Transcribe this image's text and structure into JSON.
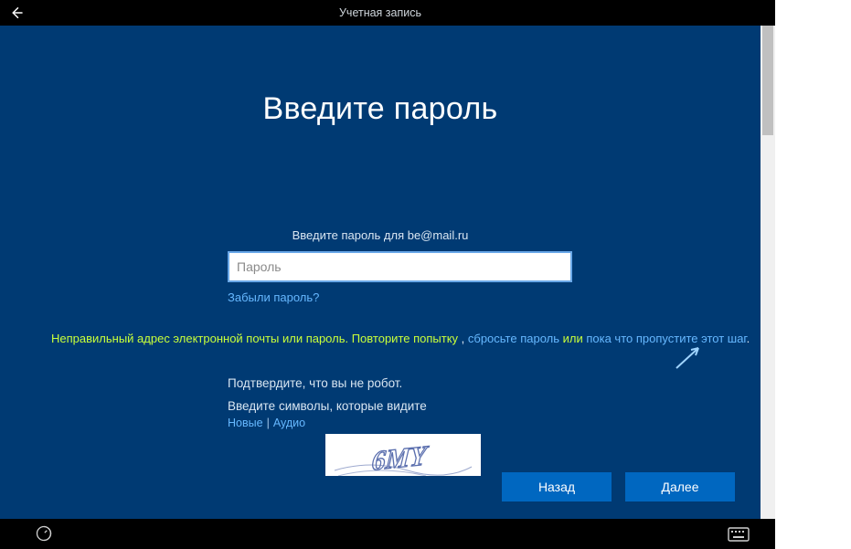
{
  "header": {
    "tab_label": "Учетная запись"
  },
  "main": {
    "heading": "Введите пароль",
    "prompt": "Введите пароль для be@mail.ru",
    "password_placeholder": "Пароль",
    "password_value": "",
    "forgot_label": "Забыли пароль?"
  },
  "error": {
    "part1": "Неправильный адрес электронной почты или пароль. Повторите попытку",
    "sep1": " , ",
    "link1": "сбросьте пароль",
    "sep2": " или ",
    "link2": "пока что пропустите этот шаг",
    "tail": "."
  },
  "captcha": {
    "title": "Подтвердите, что вы не робот.",
    "subtitle": "Введите символы, которые видите",
    "new_label": "Новые",
    "audio_label": "Аудио",
    "image_text": "6MY"
  },
  "buttons": {
    "back": "Назад",
    "next": "Далее"
  }
}
